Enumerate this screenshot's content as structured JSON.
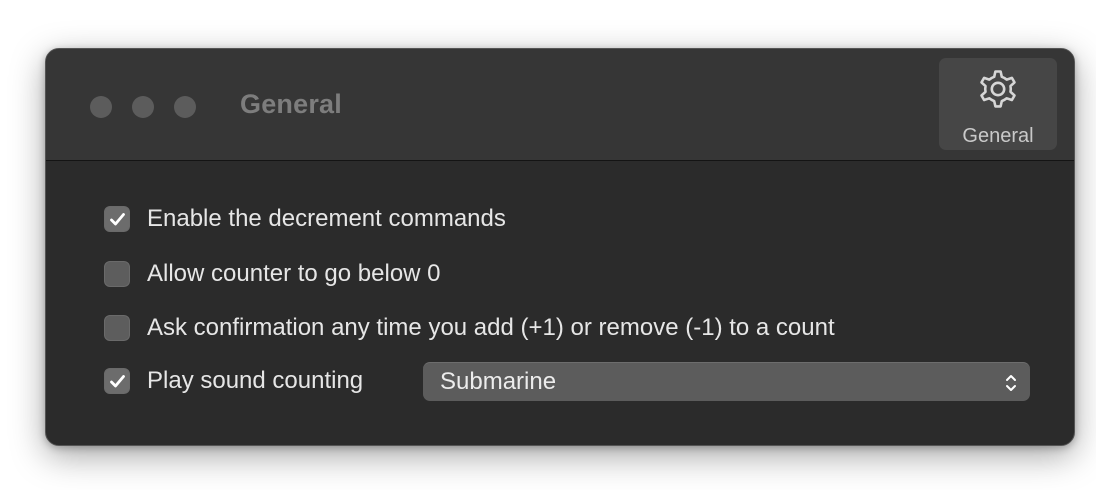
{
  "window": {
    "title": "General"
  },
  "toolbar": {
    "general": {
      "label": "General",
      "icon": "gear-icon"
    }
  },
  "settings": [
    {
      "label": "Enable the decrement commands",
      "checked": true
    },
    {
      "label": "Allow counter to go below 0",
      "checked": false
    },
    {
      "label": "Ask confirmation any time you add (+1) or remove (-1) to a count",
      "checked": false
    },
    {
      "label": "Play sound counting",
      "checked": true
    }
  ],
  "sound_select": {
    "value": "Submarine"
  },
  "colors": {
    "window_bg": "#2b2b2b",
    "titlebar_bg": "#363636",
    "text": "#e6e6e6",
    "muted_title": "#7d7d7d"
  }
}
